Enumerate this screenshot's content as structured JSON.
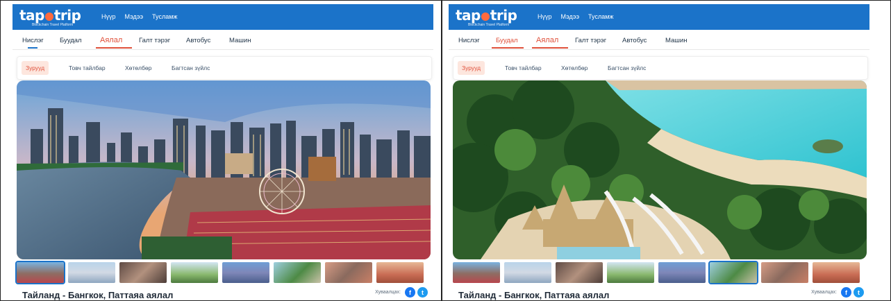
{
  "brand": {
    "logo_prefix": "tap",
    "logo_suffix": "trip",
    "tagline": "Blockchain Travel Platform"
  },
  "nav": {
    "home": "Нүүр",
    "news": "Мэдээ",
    "help": "Тусламж"
  },
  "category_tabs": [
    "Нислэг",
    "Буудал",
    "Аялал",
    "Галт тэрэг",
    "Автобус",
    "Машин"
  ],
  "detail_tabs": [
    "Зурууд",
    "Товч тайлбар",
    "Хөтөлбөр",
    "Багтсан зүйлс"
  ],
  "tour": {
    "title": "Тайланд - Бангкок, Паттаяа аялал"
  },
  "share": {
    "label": "Хуваалцах:",
    "facebook": "f",
    "twitter": "t"
  },
  "colors": {
    "brand_blue": "#1b73c9",
    "accent": "#e0503a"
  },
  "panels": [
    {
      "hero_scene": "bangkok-river-city-skyline",
      "selected_thumbnail": 1
    },
    {
      "hero_scene": "waterpark-tropical-beach",
      "selected_thumbnail": 6
    }
  ]
}
